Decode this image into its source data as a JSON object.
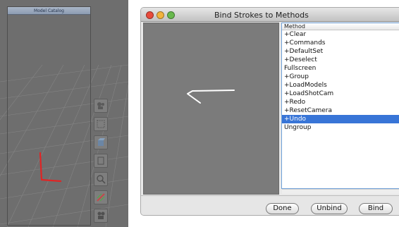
{
  "model_catalog": {
    "title": "Model Catalog"
  },
  "tools": [
    {
      "icon": "camera-icon"
    },
    {
      "icon": "dotted-rectangle-icon"
    },
    {
      "icon": "cube-icon"
    },
    {
      "icon": "square-icon"
    },
    {
      "icon": "magnifier-icon"
    },
    {
      "icon": "grid-paint-icon"
    },
    {
      "icon": "film-camera-icon"
    }
  ],
  "dialog": {
    "title": "Bind Strokes to Methods",
    "table": {
      "header": "Method",
      "rows": [
        "+Clear",
        "+Commands",
        "+DefaultSet",
        "+Deselect",
        "Fullscreen",
        "+Group",
        "+LoadModels",
        "+LoadShotCam",
        "+Redo",
        "+ResetCamera",
        "+Undo",
        "Ungroup"
      ],
      "selected_index": 10
    },
    "buttons": {
      "done": "Done",
      "unbind": "Unbind",
      "bind": "Bind"
    }
  },
  "colors": {
    "selection": "#3875d7",
    "stroke_red": "#e02424",
    "stroke_white": "#ffffff",
    "traffic_close": "#e94b3c",
    "traffic_minimize": "#f2b33d",
    "traffic_zoom": "#68b94d"
  }
}
